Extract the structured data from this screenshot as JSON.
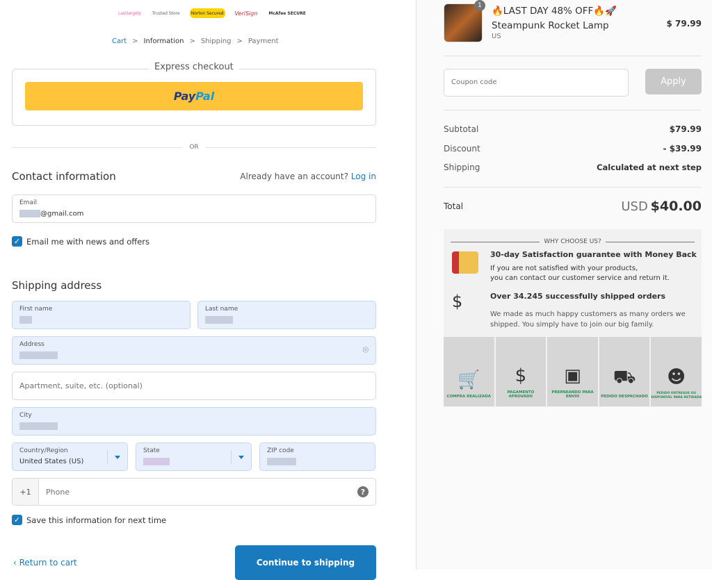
{
  "logos": [
    "Lastlargely",
    "Trusted Store",
    "Norton Secured",
    "VeriSign",
    "McAfee SECURE"
  ],
  "breadcrumb": {
    "cart": "Cart",
    "information": "Information",
    "shipping": "Shipping",
    "payment": "Payment",
    "sep": ">"
  },
  "express": {
    "title": "Express checkout",
    "paypal_1": "Pay",
    "paypal_2": "Pal"
  },
  "or": "OR",
  "contact": {
    "title": "Contact information",
    "account_prompt": "Already have an account?",
    "login": "Log in",
    "email_label": "Email",
    "email_value": "@gmail.com",
    "newsletter": "Email me with news and offers"
  },
  "shipping": {
    "title": "Shipping address",
    "first_name": "First name",
    "last_name": "Last name",
    "address": "Address",
    "apartment_placeholder": "Apartment, suite, etc. (optional)",
    "city": "City",
    "country_label": "Country/Region",
    "country_value": "United States (US)",
    "state": "State",
    "zip": "ZIP code",
    "phone_prefix": "+1",
    "phone_placeholder": "Phone",
    "save_info": "Save this information for next time"
  },
  "actions": {
    "return": "Return to cart",
    "continue": "Continue to shipping"
  },
  "summary": {
    "product_title": "🔥LAST DAY 48% OFF🔥🚀Steampunk Rocket Lamp",
    "product_variant": "US",
    "product_price": "$ 79.99",
    "quantity": "1",
    "coupon_placeholder": "Coupon code",
    "apply": "Apply",
    "subtotal_label": "Subtotal",
    "subtotal": "$79.99",
    "discount_label": "Discount",
    "discount": "- $39.99",
    "shipping_label": "Shipping",
    "shipping": "Calculated at next step",
    "total_label": "Total",
    "currency": "USD",
    "total": "$40.00"
  },
  "why": {
    "title": "WHY CHOOSE US?",
    "h1": "30-day Satisfaction guarantee with Money Back",
    "p1a": "If you are not satisfied with your products,",
    "p1b": "you can contact our customer service and return it.",
    "h2": "Over 34.245 successfully shipped orders",
    "p2a": "We made as much happy customers as many orders we",
    "p2b": "shipped. You simply have to join our big family.",
    "steps": [
      "COMPRA REALIZADA",
      "PAGAMENTO APROVADO",
      "PREPARANDO PARA ENVIO",
      "PEDIDO DESPACHADO",
      "PEDIDO ENTREGUE OU DISPONÍVEL PARA RETIRADA"
    ]
  },
  "colors": {
    "accent": "#197bbd",
    "paypal": "#ffc439",
    "step_text": "#2e8b57"
  }
}
